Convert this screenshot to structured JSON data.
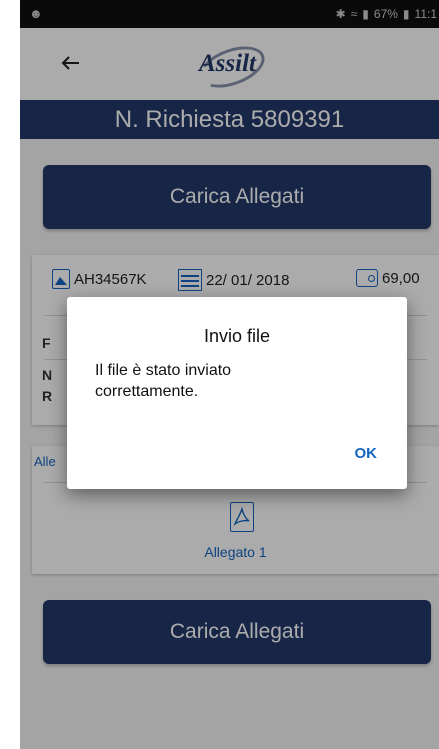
{
  "status_bar": {
    "battery": "67%",
    "time": "11:1"
  },
  "app": {
    "logo_text": "Assilt"
  },
  "header": {
    "title": "N. Richiesta 5809391"
  },
  "upload_button_top": {
    "label": "Carica Allegati"
  },
  "info_card": {
    "plate": "AH34567K",
    "date": "22/ 01/ 2018",
    "amount": "69,00",
    "row1_fragment": "F",
    "row2_fragment": "N",
    "row3_fragment": "R"
  },
  "attachments_card": {
    "label_fragment": "Alle",
    "attachment_name": "Allegato 1"
  },
  "upload_button_bottom": {
    "label": "Carica Allegati"
  },
  "dialog": {
    "title": "Invio file",
    "message": "Il file è stato inviato correttamente.",
    "ok_label": "OK"
  }
}
